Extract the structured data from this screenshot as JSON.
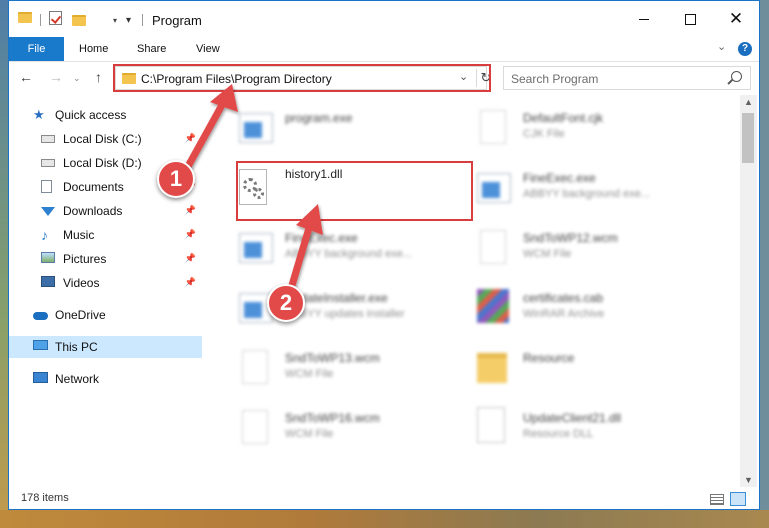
{
  "window": {
    "title": "Program"
  },
  "ribbon": {
    "tabs": [
      {
        "label": "File"
      },
      {
        "label": "Home"
      },
      {
        "label": "Share"
      },
      {
        "label": "View"
      }
    ],
    "help_label": "?"
  },
  "address": {
    "path": "C:\\Program Files\\Program Directory"
  },
  "search": {
    "placeholder": "Search Program"
  },
  "sidebar": {
    "items": [
      {
        "label": "Quick access"
      },
      {
        "label": "Local Disk (C:)"
      },
      {
        "label": "Local Disk (D:)"
      },
      {
        "label": "Documents"
      },
      {
        "label": "Downloads"
      },
      {
        "label": "Music"
      },
      {
        "label": "Pictures"
      },
      {
        "label": "Videos"
      },
      {
        "label": "OneDrive"
      },
      {
        "label": "This PC"
      },
      {
        "label": "Network"
      }
    ]
  },
  "files": [
    {
      "name": "program.exe",
      "type": ""
    },
    {
      "name": "DefaultFont.cjk",
      "type": "CJK File"
    },
    {
      "name": "history1.dll",
      "type": ""
    },
    {
      "name": "FineExec.exe",
      "type": "ABBYY background exe..."
    },
    {
      "name": "FineExec.exe",
      "type": "ABBYY background exe..."
    },
    {
      "name": "SndToWP12.wcm",
      "type": "WCM File"
    },
    {
      "name": "UpdateInstaller.exe",
      "type": "ABBYY updates installer"
    },
    {
      "name": "certificates.cab",
      "type": "WinRAR Archive"
    },
    {
      "name": "SndToWP13.wcm",
      "type": "WCM File"
    },
    {
      "name": "Resource",
      "type": ""
    },
    {
      "name": "SndToWP16.wcm",
      "type": "WCM File"
    },
    {
      "name": "UpdateClient21.dll",
      "type": "Resource DLL"
    }
  ],
  "status": {
    "item_count": "178 items"
  },
  "annotations": {
    "badge1": "1",
    "badge2": "2"
  },
  "colors": {
    "accent": "#1979ca",
    "highlight": "#d93c3c",
    "selection": "#cce8ff"
  }
}
